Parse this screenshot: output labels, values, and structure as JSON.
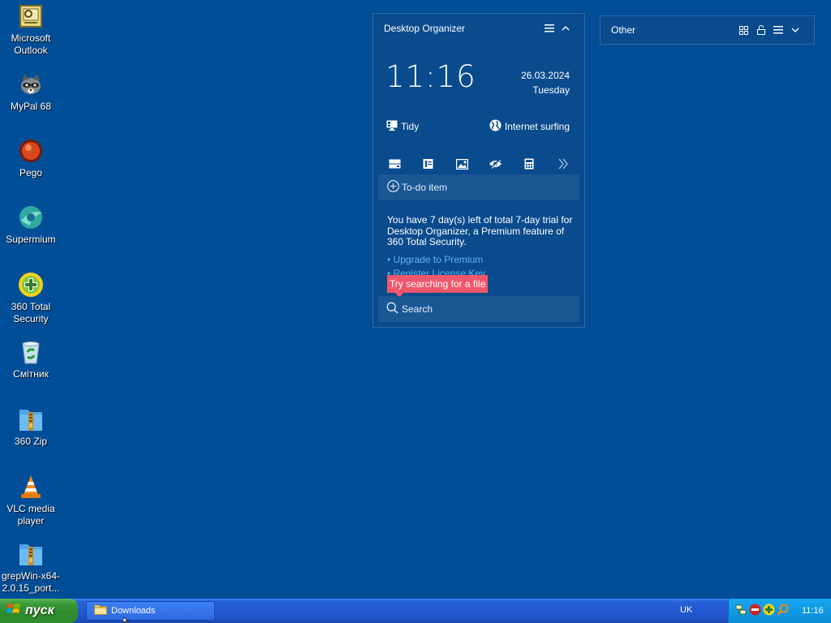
{
  "desktop_icons": [
    {
      "label": "Microsoft Outlook",
      "icon": "outlook-icon"
    },
    {
      "label": "MyPal 68",
      "icon": "raccoon-browser-icon"
    },
    {
      "label": "Pego",
      "icon": "pego-icon"
    },
    {
      "label": "Supermium",
      "icon": "supermium-icon"
    },
    {
      "label": "360 Total Security",
      "icon": "plus-shield-icon"
    },
    {
      "label": "Смітник",
      "icon": "recycle-bin-icon"
    },
    {
      "label": "360 Zip",
      "icon": "zip-folder-icon"
    },
    {
      "label": "VLC media player",
      "icon": "vlc-cone-icon"
    },
    {
      "label": "grepWin-x64-2.0.15_port...",
      "icon": "zip-folder-icon"
    }
  ],
  "organizer": {
    "title": "Desktop Organizer",
    "time": "11:16",
    "date": "26.03.2024",
    "weekday": "Tuesday",
    "tidy_label": "Tidy",
    "internet_label": "Internet surfing",
    "todo_label": "To-do item",
    "trial_text": "You have 7 day(s) left of total 7-day trial for Desktop Organizer, a Premium feature of 360 Total Security.",
    "upgrade_link": "• Upgrade to Premium",
    "register_link": "• Register License Key",
    "tooltip": "Try searching for a file",
    "search_placeholder": "Search"
  },
  "other_panel": {
    "title": "Other"
  },
  "taskbar": {
    "start_label": "пуск",
    "task_label": "Downloads",
    "language": "UK",
    "clock": "11:16"
  },
  "colors": {
    "desktop": "#004E98",
    "panel": "#0A4B8E",
    "tooltip": "#F0576A",
    "link": "#5BB4F0"
  }
}
